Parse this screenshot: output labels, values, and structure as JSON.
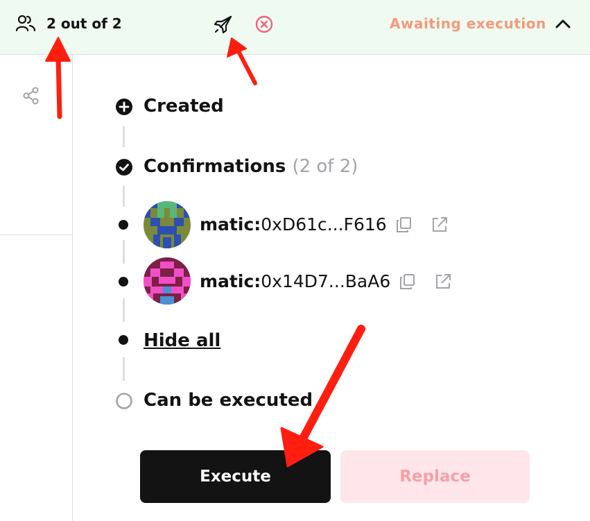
{
  "header": {
    "signers_icon": "people-icon",
    "confirmations_count": "2 out of 2",
    "action_icons": [
      "rocket-icon",
      "cancel-icon"
    ],
    "status": "Awaiting execution",
    "collapse_icon": "chevron-up-icon"
  },
  "sidebar": {
    "share_icon": "share-icon"
  },
  "timeline": {
    "created": {
      "label": "Created",
      "icon": "plus-circle-icon"
    },
    "confirmations": {
      "label": "Confirmations",
      "count": "(2 of 2)",
      "icon": "check-circle-icon"
    },
    "owners": [
      {
        "prefix": "matic:",
        "address": "0xD61c...F616",
        "avatar_colors": [
          "#2c4fb3",
          "#7b8a3a",
          "#57b878"
        ]
      },
      {
        "prefix": "matic:",
        "address": "0x14D7...BaA6",
        "avatar_colors": [
          "#7c2044",
          "#f14fc8",
          "#4c8fd2"
        ]
      }
    ],
    "hide_all_label": "Hide all",
    "can_be_executed": {
      "label": "Can be executed",
      "icon": "empty-circle-icon"
    }
  },
  "actions": {
    "execute_label": "Execute",
    "replace_label": "Replace"
  },
  "colors": {
    "header_bg": "#effaf1",
    "status_text": "#f39a7b",
    "cancel_icon": "#f0637b",
    "replace_bg": "#ffe6ea",
    "replace_text": "#f5a0a8",
    "arrow": "#ff1e0f"
  }
}
